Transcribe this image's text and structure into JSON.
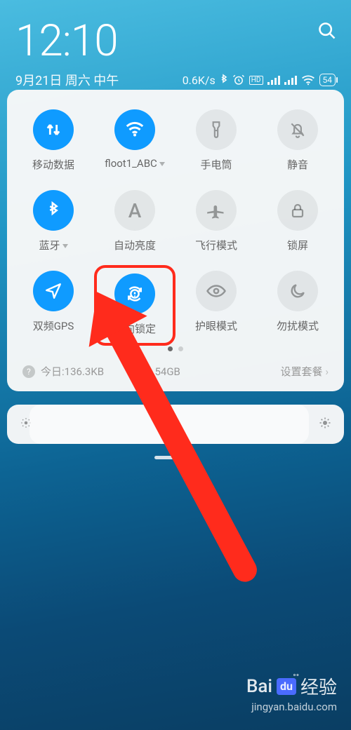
{
  "status": {
    "time": "12:10",
    "date": "9月21日 周六 中午",
    "speed": "0.6K/s",
    "battery": "54"
  },
  "tiles": [
    {
      "name": "mobile-data",
      "label": "移动数据",
      "on": true,
      "expand": false,
      "icon": "arrows"
    },
    {
      "name": "wifi",
      "label": "floot1_ABC",
      "on": true,
      "expand": true,
      "icon": "wifi"
    },
    {
      "name": "flashlight",
      "label": "手电筒",
      "on": false,
      "expand": false,
      "icon": "torch"
    },
    {
      "name": "mute",
      "label": "静音",
      "on": false,
      "expand": false,
      "icon": "bell"
    },
    {
      "name": "bluetooth",
      "label": "蓝牙",
      "on": true,
      "expand": true,
      "icon": "bt"
    },
    {
      "name": "auto-brightness",
      "label": "自动亮度",
      "on": false,
      "expand": false,
      "icon": "A"
    },
    {
      "name": "airplane",
      "label": "飞行模式",
      "on": false,
      "expand": false,
      "icon": "plane"
    },
    {
      "name": "lockscreen",
      "label": "锁屏",
      "on": false,
      "expand": false,
      "icon": "lock"
    },
    {
      "name": "gps",
      "label": "双频GPS",
      "on": true,
      "expand": false,
      "icon": "send"
    },
    {
      "name": "orientation-lock",
      "label": "方向锁定",
      "on": true,
      "expand": false,
      "icon": "rot",
      "highlight": true
    },
    {
      "name": "eye-mode",
      "label": "护眼模式",
      "on": false,
      "expand": false,
      "icon": "eye"
    },
    {
      "name": "dnd",
      "label": "勿扰模式",
      "on": false,
      "expand": false,
      "icon": "moon"
    }
  ],
  "usage": {
    "today_label": "今日:",
    "today_value": "136.3KB",
    "total_value": "2.54GB",
    "plan_label": "设置套餐"
  },
  "watermark": {
    "brand_prefix": "Bai",
    "brand_badge": "du",
    "brand_suffix": "经验",
    "url": "jingyan.baidu.com"
  }
}
